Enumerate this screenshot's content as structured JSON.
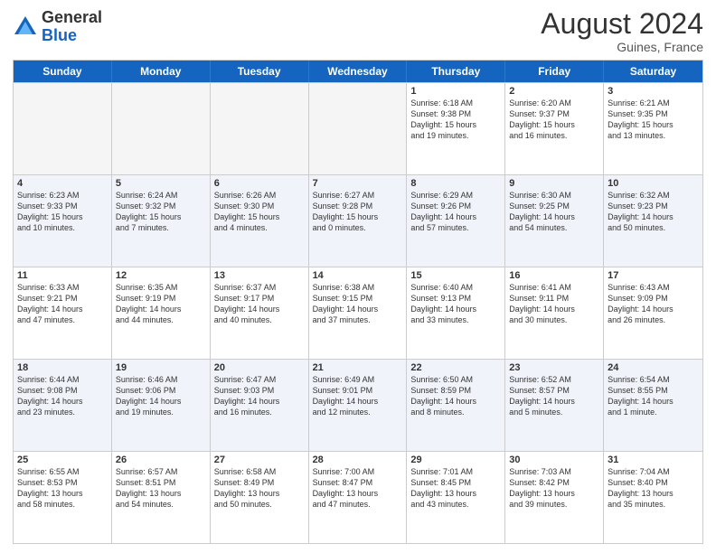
{
  "header": {
    "logo_general": "General",
    "logo_blue": "Blue",
    "month_title": "August 2024",
    "location": "Guines, France"
  },
  "calendar": {
    "days_of_week": [
      "Sunday",
      "Monday",
      "Tuesday",
      "Wednesday",
      "Thursday",
      "Friday",
      "Saturday"
    ],
    "rows": [
      [
        {
          "day": "",
          "empty": true
        },
        {
          "day": "",
          "empty": true
        },
        {
          "day": "",
          "empty": true
        },
        {
          "day": "",
          "empty": true
        },
        {
          "day": "1",
          "info": "Sunrise: 6:18 AM\nSunset: 9:38 PM\nDaylight: 15 hours\nand 19 minutes."
        },
        {
          "day": "2",
          "info": "Sunrise: 6:20 AM\nSunset: 9:37 PM\nDaylight: 15 hours\nand 16 minutes."
        },
        {
          "day": "3",
          "info": "Sunrise: 6:21 AM\nSunset: 9:35 PM\nDaylight: 15 hours\nand 13 minutes."
        }
      ],
      [
        {
          "day": "4",
          "info": "Sunrise: 6:23 AM\nSunset: 9:33 PM\nDaylight: 15 hours\nand 10 minutes."
        },
        {
          "day": "5",
          "info": "Sunrise: 6:24 AM\nSunset: 9:32 PM\nDaylight: 15 hours\nand 7 minutes."
        },
        {
          "day": "6",
          "info": "Sunrise: 6:26 AM\nSunset: 9:30 PM\nDaylight: 15 hours\nand 4 minutes."
        },
        {
          "day": "7",
          "info": "Sunrise: 6:27 AM\nSunset: 9:28 PM\nDaylight: 15 hours\nand 0 minutes."
        },
        {
          "day": "8",
          "info": "Sunrise: 6:29 AM\nSunset: 9:26 PM\nDaylight: 14 hours\nand 57 minutes."
        },
        {
          "day": "9",
          "info": "Sunrise: 6:30 AM\nSunset: 9:25 PM\nDaylight: 14 hours\nand 54 minutes."
        },
        {
          "day": "10",
          "info": "Sunrise: 6:32 AM\nSunset: 9:23 PM\nDaylight: 14 hours\nand 50 minutes."
        }
      ],
      [
        {
          "day": "11",
          "info": "Sunrise: 6:33 AM\nSunset: 9:21 PM\nDaylight: 14 hours\nand 47 minutes."
        },
        {
          "day": "12",
          "info": "Sunrise: 6:35 AM\nSunset: 9:19 PM\nDaylight: 14 hours\nand 44 minutes."
        },
        {
          "day": "13",
          "info": "Sunrise: 6:37 AM\nSunset: 9:17 PM\nDaylight: 14 hours\nand 40 minutes."
        },
        {
          "day": "14",
          "info": "Sunrise: 6:38 AM\nSunset: 9:15 PM\nDaylight: 14 hours\nand 37 minutes."
        },
        {
          "day": "15",
          "info": "Sunrise: 6:40 AM\nSunset: 9:13 PM\nDaylight: 14 hours\nand 33 minutes."
        },
        {
          "day": "16",
          "info": "Sunrise: 6:41 AM\nSunset: 9:11 PM\nDaylight: 14 hours\nand 30 minutes."
        },
        {
          "day": "17",
          "info": "Sunrise: 6:43 AM\nSunset: 9:09 PM\nDaylight: 14 hours\nand 26 minutes."
        }
      ],
      [
        {
          "day": "18",
          "info": "Sunrise: 6:44 AM\nSunset: 9:08 PM\nDaylight: 14 hours\nand 23 minutes."
        },
        {
          "day": "19",
          "info": "Sunrise: 6:46 AM\nSunset: 9:06 PM\nDaylight: 14 hours\nand 19 minutes."
        },
        {
          "day": "20",
          "info": "Sunrise: 6:47 AM\nSunset: 9:03 PM\nDaylight: 14 hours\nand 16 minutes."
        },
        {
          "day": "21",
          "info": "Sunrise: 6:49 AM\nSunset: 9:01 PM\nDaylight: 14 hours\nand 12 minutes."
        },
        {
          "day": "22",
          "info": "Sunrise: 6:50 AM\nSunset: 8:59 PM\nDaylight: 14 hours\nand 8 minutes."
        },
        {
          "day": "23",
          "info": "Sunrise: 6:52 AM\nSunset: 8:57 PM\nDaylight: 14 hours\nand 5 minutes."
        },
        {
          "day": "24",
          "info": "Sunrise: 6:54 AM\nSunset: 8:55 PM\nDaylight: 14 hours\nand 1 minute."
        }
      ],
      [
        {
          "day": "25",
          "info": "Sunrise: 6:55 AM\nSunset: 8:53 PM\nDaylight: 13 hours\nand 58 minutes."
        },
        {
          "day": "26",
          "info": "Sunrise: 6:57 AM\nSunset: 8:51 PM\nDaylight: 13 hours\nand 54 minutes."
        },
        {
          "day": "27",
          "info": "Sunrise: 6:58 AM\nSunset: 8:49 PM\nDaylight: 13 hours\nand 50 minutes."
        },
        {
          "day": "28",
          "info": "Sunrise: 7:00 AM\nSunset: 8:47 PM\nDaylight: 13 hours\nand 47 minutes."
        },
        {
          "day": "29",
          "info": "Sunrise: 7:01 AM\nSunset: 8:45 PM\nDaylight: 13 hours\nand 43 minutes."
        },
        {
          "day": "30",
          "info": "Sunrise: 7:03 AM\nSunset: 8:42 PM\nDaylight: 13 hours\nand 39 minutes."
        },
        {
          "day": "31",
          "info": "Sunrise: 7:04 AM\nSunset: 8:40 PM\nDaylight: 13 hours\nand 35 minutes."
        }
      ]
    ]
  }
}
